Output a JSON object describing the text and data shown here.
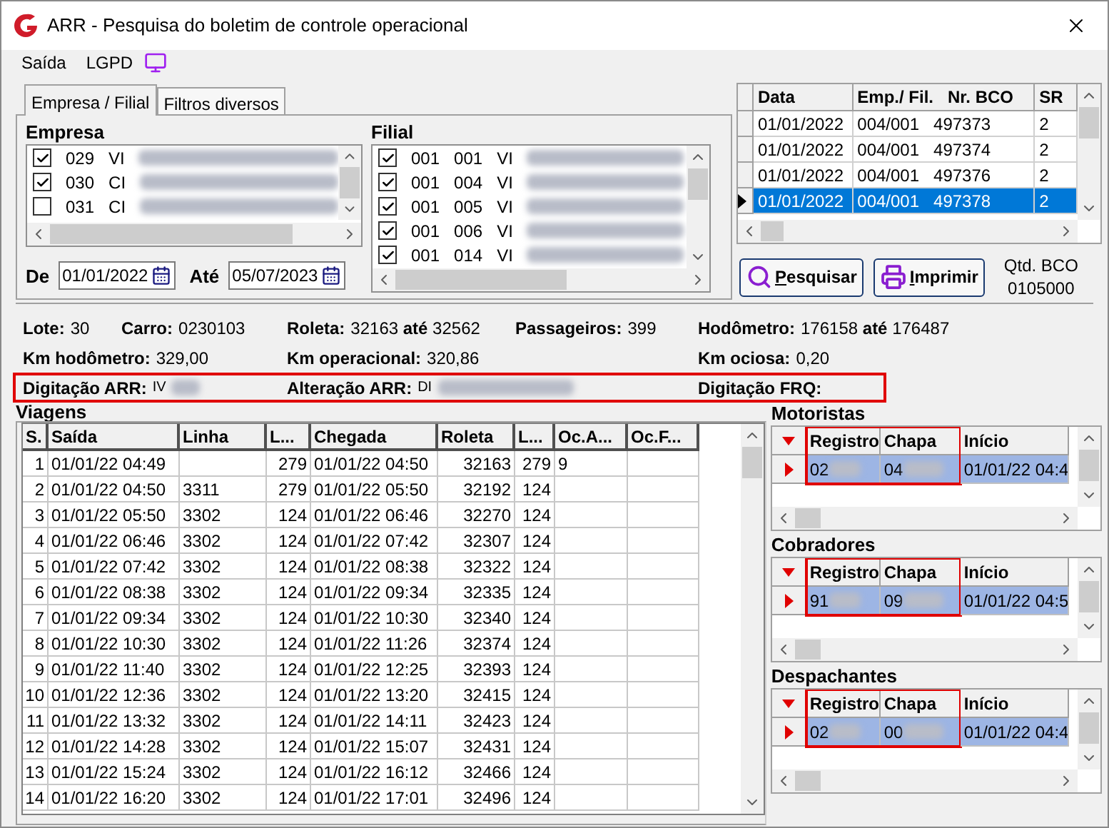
{
  "window": {
    "title": "ARR - Pesquisa do boletim de controle operacional"
  },
  "menu": [
    {
      "label": "Saída",
      "kind": "text"
    },
    {
      "label": "LGPD",
      "kind": "monitor"
    }
  ],
  "tabs": [
    {
      "label": "Empresa / Filial",
      "selected": true
    },
    {
      "label": "Filtros diversos",
      "selected": false
    }
  ],
  "empresa": {
    "label": "Empresa",
    "items": [
      {
        "code": "029",
        "name": "VI",
        "checked": true
      },
      {
        "code": "030",
        "name": "CI",
        "checked": true
      },
      {
        "code": "031",
        "name": "CI",
        "checked": false
      }
    ]
  },
  "filial": {
    "label": "Filial",
    "items": [
      {
        "code": "001",
        "branch": "001",
        "name": "VI",
        "checked": true
      },
      {
        "code": "001",
        "branch": "004",
        "name": "VI",
        "checked": true
      },
      {
        "code": "001",
        "branch": "005",
        "name": "VI",
        "checked": true
      },
      {
        "code": "001",
        "branch": "006",
        "name": "VI",
        "checked": true
      },
      {
        "code": "001",
        "branch": "014",
        "name": "VI",
        "checked": true
      }
    ]
  },
  "date_from": {
    "label": "De",
    "value": "01/01/2022"
  },
  "date_to": {
    "label": "Até",
    "value": "05/07/2023"
  },
  "bco_grid": {
    "columns": [
      "Data",
      "Emp./ Fil.   Nr. BCO",
      "SR"
    ],
    "rows": [
      {
        "cells": [
          "01/01/2022",
          "004/001   497373",
          "2"
        ],
        "selected": false
      },
      {
        "cells": [
          "01/01/2022",
          "004/001   497374",
          "2"
        ],
        "selected": false
      },
      {
        "cells": [
          "01/01/2022",
          "004/001   497376",
          "2"
        ],
        "selected": false
      },
      {
        "cells": [
          "01/01/2022",
          "004/001   497378",
          "2"
        ],
        "selected": true
      }
    ]
  },
  "buttons": [
    {
      "label": "Pesquisar",
      "kind": "search"
    },
    {
      "label": "Imprimir",
      "kind": "print"
    }
  ],
  "qtd_bco": {
    "label": "Qtd. BCO",
    "value": "0105000"
  },
  "info_rows": [
    {
      "highlighted": false,
      "fields": [
        {
          "label": "Lote:",
          "value": "30"
        },
        {
          "label": "Carro:",
          "value": "0230103"
        },
        {
          "label": "Roleta:",
          "value": "32163  **até**  32562"
        },
        {
          "label": "Passageiros:",
          "value": "399"
        },
        {
          "label": "Hodômetro:",
          "value": "176158 **até** 176487"
        }
      ]
    },
    {
      "highlighted": false,
      "fields": [
        {
          "label": "Km hodômetro:",
          "value": "329,00"
        },
        {
          "label": "Km operacional:",
          "value": "320,86"
        },
        {
          "label": "Km ociosa:",
          "value": "0,20"
        }
      ]
    },
    {
      "highlighted": true,
      "fields": [
        {
          "label": "Digitação ARR:",
          "value": "IV",
          "redacted": true
        },
        {
          "label": "Alteração ARR:",
          "value": "DI",
          "redacted": true
        },
        {
          "label": "Digitação FRQ:"
        }
      ]
    }
  ],
  "viagens": {
    "title": "Viagens",
    "columns": [
      "S.",
      "Saída",
      "Linha",
      "L...",
      "Chegada",
      "Roleta",
      "L...",
      "Oc.A...",
      "Oc.F..."
    ],
    "rows": [
      [
        "1",
        "01/01/22 04:49",
        null,
        "279",
        "01/01/22 04:50",
        "32163",
        "279",
        "9",
        null
      ],
      [
        "2",
        "01/01/22 04:50",
        "3311",
        "279",
        "01/01/22 05:50",
        "32192",
        "124",
        null,
        null
      ],
      [
        "3",
        "01/01/22 05:50",
        "3302",
        "124",
        "01/01/22 06:46",
        "32270",
        "124",
        null,
        null
      ],
      [
        "4",
        "01/01/22 06:46",
        "3302",
        "124",
        "01/01/22 07:42",
        "32307",
        "124",
        null,
        null
      ],
      [
        "5",
        "01/01/22 07:42",
        "3302",
        "124",
        "01/01/22 08:38",
        "32322",
        "124",
        null,
        null
      ],
      [
        "6",
        "01/01/22 08:38",
        "3302",
        "124",
        "01/01/22 09:34",
        "32335",
        "124",
        null,
        null
      ],
      [
        "7",
        "01/01/22 09:34",
        "3302",
        "124",
        "01/01/22 10:30",
        "32340",
        "124",
        null,
        null
      ],
      [
        "8",
        "01/01/22 10:30",
        "3302",
        "124",
        "01/01/22 11:26",
        "32374",
        "124",
        null,
        null
      ],
      [
        "9",
        "01/01/22 11:40",
        "3302",
        "124",
        "01/01/22 12:25",
        "32393",
        "124",
        null,
        null
      ],
      [
        "10",
        "01/01/22 12:36",
        "3302",
        "124",
        "01/01/22 13:20",
        "32415",
        "124",
        null,
        null
      ],
      [
        "11",
        "01/01/22 13:32",
        "3302",
        "124",
        "01/01/22 14:11",
        "32423",
        "124",
        null,
        null
      ],
      [
        "12",
        "01/01/22 14:28",
        "3302",
        "124",
        "01/01/22 15:07",
        "32431",
        "124",
        null,
        null
      ],
      [
        "13",
        "01/01/22 15:24",
        "3302",
        "124",
        "01/01/22 16:12",
        "32466",
        "124",
        null,
        null
      ],
      [
        "14",
        "01/01/22 16:20",
        "3302",
        "124",
        "01/01/22 17:01",
        "32496",
        "124",
        null,
        null
      ]
    ]
  },
  "crews": [
    {
      "title": "Motoristas",
      "highlighted": true,
      "columns": [
        "Registro",
        "Chapa",
        "Início"
      ],
      "rows": [
        {
          "cells": [
            "02",
            "04",
            "01/01/22 04:4"
          ],
          "selected": true
        }
      ]
    },
    {
      "title": "Cobradores",
      "highlighted": true,
      "columns": [
        "Registro",
        "Chapa",
        "Início"
      ],
      "rows": [
        {
          "cells": [
            "91",
            "09",
            "01/01/22 04:5"
          ],
          "selected": true
        }
      ]
    },
    {
      "title": "Despachantes",
      "highlighted": true,
      "columns": [
        "Registro",
        "Chapa",
        "Início"
      ],
      "rows": [
        {
          "cells": [
            "02",
            "00",
            "01/01/22 04:4"
          ],
          "selected": true
        }
      ]
    }
  ]
}
